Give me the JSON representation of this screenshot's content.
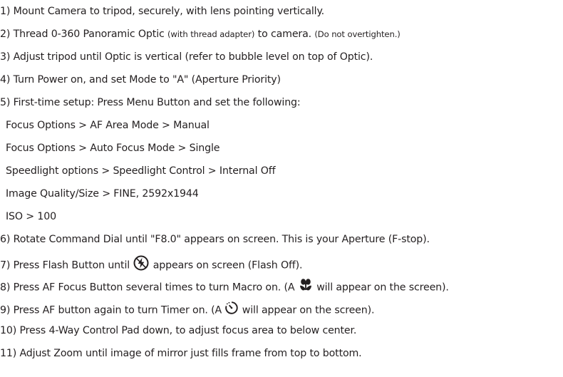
{
  "steps": [
    {
      "text": "1) Mount Camera to tripod, securely, with lens pointing vertically."
    },
    {
      "main": "2) Thread 0-360 Panoramic Optic ",
      "note1": "(with thread adapter)",
      "mid": " to camera.  ",
      "note2": "(Do not overtighten.)"
    },
    {
      "text": "3) Adjust tripod until Optic is vertical (refer to bubble level on top of Optic)."
    },
    {
      "text": "4) Turn Power on, and set Mode to \"A\" (Aperture Priority)"
    },
    {
      "text": "5) First-time setup: Press Menu Button and set the following:"
    },
    {
      "text": "Focus Options > AF Area Mode > Manual"
    },
    {
      "text": "Focus Options > Auto Focus Mode > Single"
    },
    {
      "text": "Speedlight options > Speedlight Control > Internal Off"
    },
    {
      "text": "Image Quality/Size > FINE,  2592x1944"
    },
    {
      "text": "ISO > 100"
    },
    {
      "text": "6) Rotate Command Dial until \"F8.0\" appears on screen.  This is your Aperture (F-stop)."
    },
    {
      "before": "7) Press Flash Button until ",
      "after": " appears on screen (Flash Off)."
    },
    {
      "before": "8) Press AF Focus Button several times to turn Macro on. (A ",
      "after": " will appear on the screen)."
    },
    {
      "before": "9) Press AF button again to turn Timer on.  (A ",
      "after": " will appear on the screen)."
    },
    {
      "text": "10) Press 4-Way Control Pad down, to adjust focus area to below center."
    },
    {
      "text": "11) Adjust Zoom until image of mirror just fills frame from top to bottom."
    }
  ],
  "icons": {
    "flash_off": "flash-off-icon",
    "macro": "macro-flower-icon",
    "timer": "self-timer-icon"
  }
}
